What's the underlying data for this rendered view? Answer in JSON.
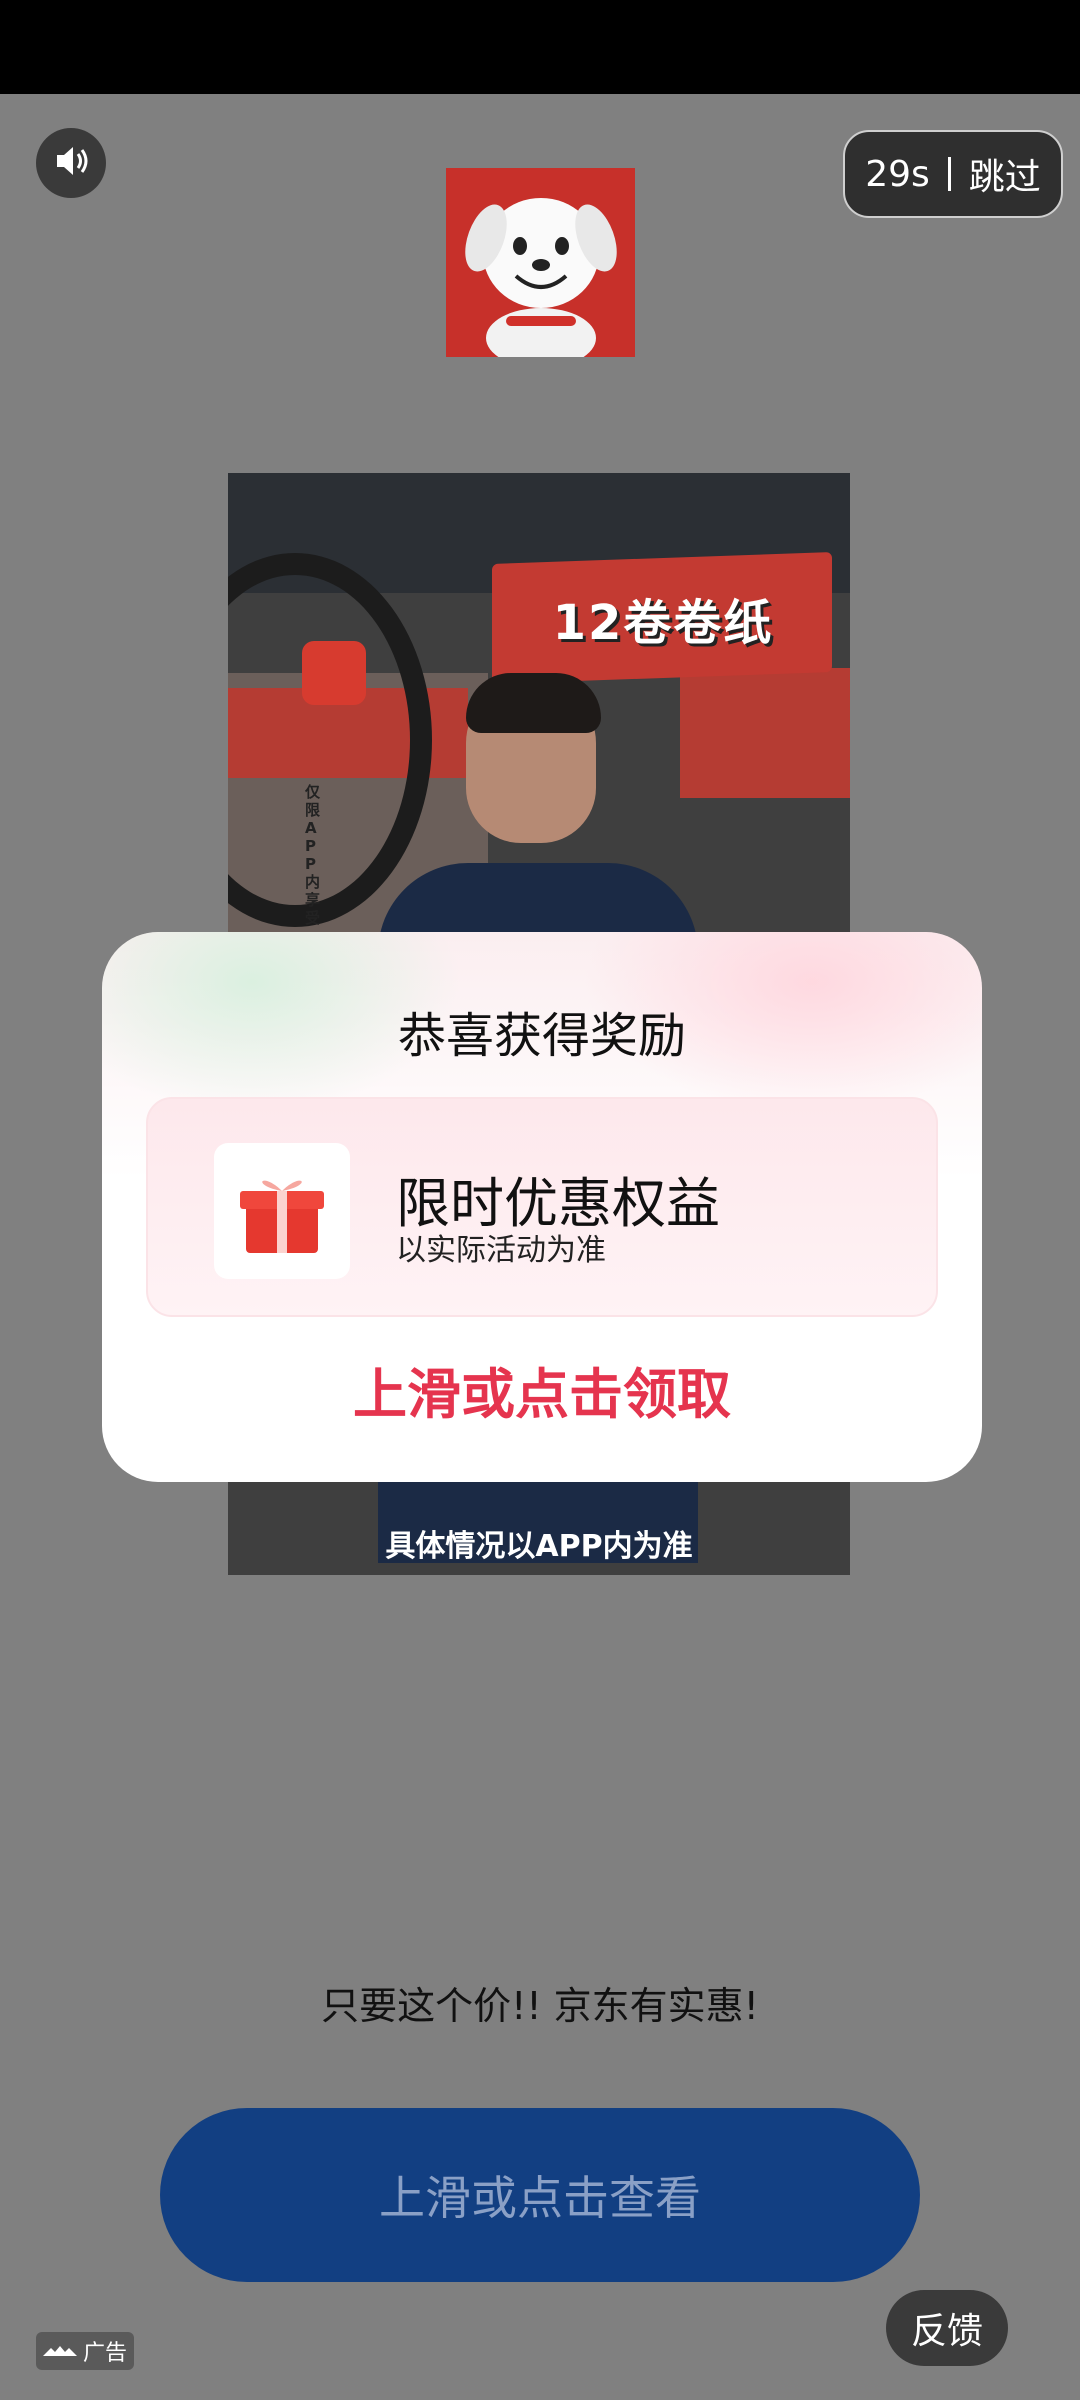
{
  "skip_button": {
    "countdown": "29s",
    "label": "跳过"
  },
  "video": {
    "banner_text": "12卷卷纸",
    "vertical_text": "仅限APP内享受",
    "caption": "具体情况以APP内为准"
  },
  "reward_modal": {
    "title": "恭喜获得奖励",
    "card_title": "限时优惠权益",
    "card_subtitle": "以实际活动为准",
    "cta": "上滑或点击领取"
  },
  "slogan": "只要这个价!! 京东有实惠!",
  "main_button": {
    "label": "上滑或点击查看"
  },
  "feedback_button": {
    "label": "反馈"
  },
  "ad_label": {
    "text": "广告"
  },
  "colors": {
    "overlay": "#808080",
    "primary_button": "#123f82",
    "cta_red": "#e5344e",
    "brand_red": "#c7302a"
  },
  "icons": [
    "speaker-icon",
    "gift-icon",
    "ad-source-icon",
    "jd-dog-logo"
  ]
}
